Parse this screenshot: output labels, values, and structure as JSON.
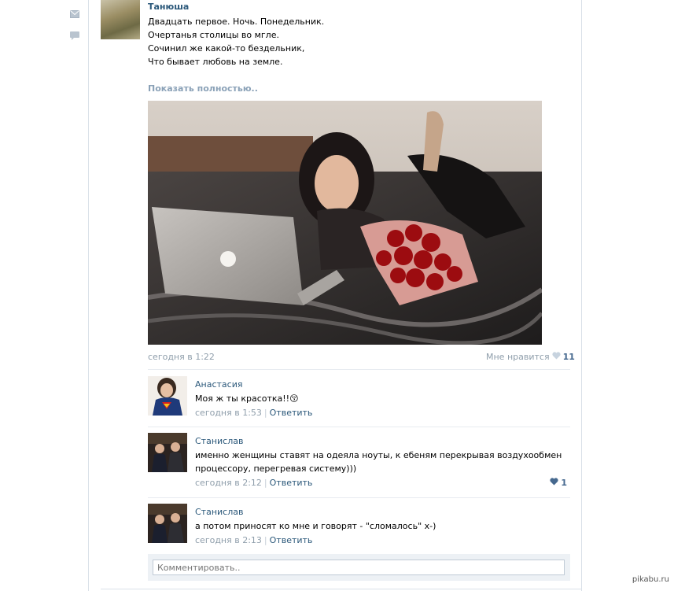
{
  "colors": {
    "link": "#2b587a",
    "muted": "#8f9eab",
    "show_more": "#8aa1b7",
    "heart": "#45688e"
  },
  "rail": {
    "icons": [
      "mail-icon",
      "comment-icon"
    ]
  },
  "post": {
    "author": "Танюша",
    "lines": [
      "Двадцать первое. Ночь. Понедельник.",
      "Очертанья столицы во мгле.",
      "Сочинил же какой-то бездельник,",
      "Что бывает любовь на земле."
    ],
    "show_more": "Показать полностью..",
    "date": "сегодня в 1:22",
    "like_label": "Мне нравится",
    "like_count": "11"
  },
  "comments": [
    {
      "name": "Анастасия",
      "text": "Моя ж ты красотка!!😚",
      "date": "сегодня в 1:53",
      "reply": "Ответить",
      "likes": ""
    },
    {
      "name": "Станислав",
      "text": "именно женщины ставят на одеяла ноуты, к ебеням перекрывая воздухообмен процессору, перегревая систему)))",
      "date": "сегодня в 2:12",
      "reply": "Ответить",
      "likes": "1"
    },
    {
      "name": "Станислав",
      "text": "а потом приносят ко мне и говорят - \"сломалось\" х-)",
      "date": "сегодня в 2:13",
      "reply": "Ответить",
      "likes": ""
    }
  ],
  "comment_box": {
    "placeholder": "Комментировать.."
  },
  "watermark": "pikabu.ru"
}
